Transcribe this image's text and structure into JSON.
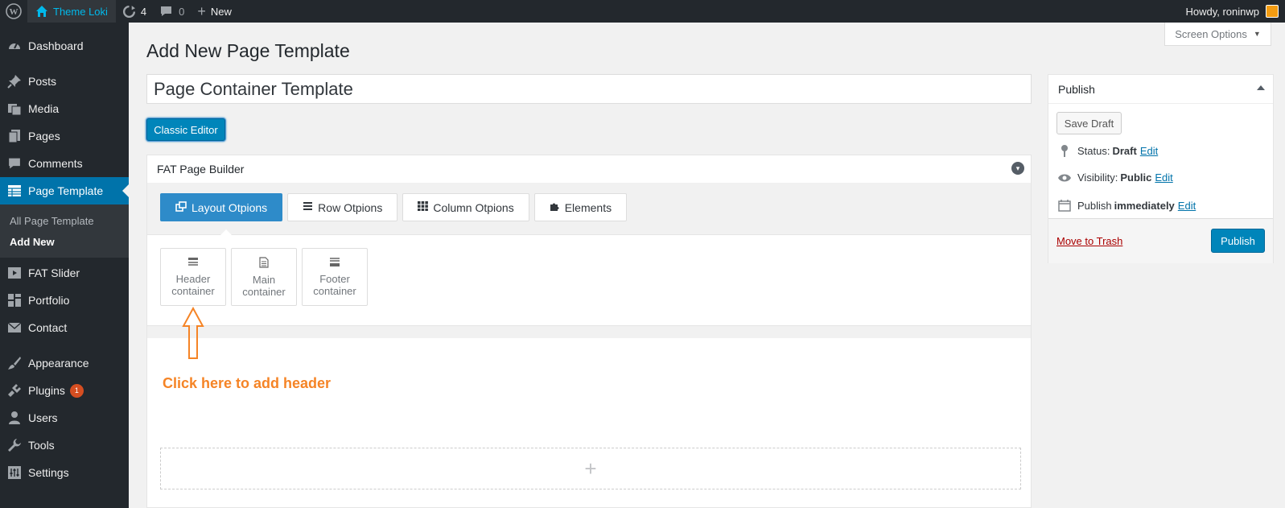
{
  "adminbar": {
    "site_name": "Theme Loki",
    "updates_count": "4",
    "comments_count": "0",
    "new_label": "New",
    "howdy": "Howdy, roninwp"
  },
  "sidebar": {
    "items": [
      {
        "label": "Dashboard",
        "icon": "dashboard-icon"
      },
      {
        "label": "Posts",
        "icon": "pin-icon"
      },
      {
        "label": "Media",
        "icon": "media-icon"
      },
      {
        "label": "Pages",
        "icon": "pages-icon"
      },
      {
        "label": "Comments",
        "icon": "comments-icon"
      },
      {
        "label": "Page Template",
        "icon": "table-icon"
      },
      {
        "label": "FAT Slider",
        "icon": "slider-icon"
      },
      {
        "label": "Portfolio",
        "icon": "portfolio-icon"
      },
      {
        "label": "Contact",
        "icon": "email-icon"
      },
      {
        "label": "Appearance",
        "icon": "brush-icon"
      },
      {
        "label": "Plugins",
        "icon": "plugin-icon",
        "badge": "1"
      },
      {
        "label": "Users",
        "icon": "users-icon"
      },
      {
        "label": "Tools",
        "icon": "wrench-icon"
      },
      {
        "label": "Settings",
        "icon": "settings-icon"
      }
    ],
    "submenu": {
      "all": "All Page Template",
      "add_new": "Add New"
    }
  },
  "screen_options": "Screen Options",
  "page_title": "Add New Page Template",
  "title_value": "Page Container Template",
  "classic_editor": "Classic Editor",
  "builder": {
    "title": "FAT Page Builder",
    "tabs": [
      {
        "label": "Layout Otpions"
      },
      {
        "label": "Row Otpions"
      },
      {
        "label": "Column Otpions"
      },
      {
        "label": "Elements"
      }
    ],
    "layout_items": [
      {
        "line1": "Header",
        "line2": "container"
      },
      {
        "line1": "Main",
        "line2": "container"
      },
      {
        "line1": "Footer",
        "line2": "container"
      }
    ],
    "add_symbol": "+"
  },
  "annotation": "Click here to add header",
  "publish": {
    "title": "Publish",
    "save_draft": "Save Draft",
    "status_label": "Status:",
    "status_value": "Draft",
    "visibility_label": "Visibility:",
    "visibility_value": "Public",
    "publish_label": "Publish",
    "publish_value": "immediately",
    "edit": "Edit",
    "trash": "Move to Trash",
    "publish_button": "Publish"
  },
  "colors": {
    "admin_dark": "#23282d",
    "accent": "#0073aa",
    "annotation": "#f58426"
  }
}
